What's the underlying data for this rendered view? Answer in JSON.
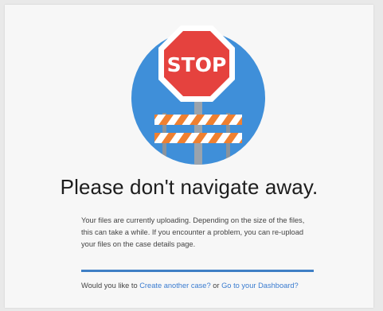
{
  "illustration": {
    "sign_text": "STOP",
    "colors": {
      "circle": "#3f8fd9",
      "sign_red": "#e5423e",
      "barrier_orange": "#f08030",
      "barrier_white": "#ffffff",
      "post_gray": "#9aa3ad"
    }
  },
  "heading": "Please don't navigate away.",
  "message": "Your files are currently uploading. Depending on the size of the files, this can take a while. If you encounter a problem, you can re-upload your files on the case details page.",
  "progress": {
    "fraction": 1.0,
    "color": "#3f7fc5"
  },
  "prompt": {
    "prefix": "Would you like to ",
    "create_link": "Create another case?",
    "middle": " or ",
    "dashboard_link": "Go to your Dashboard?"
  }
}
